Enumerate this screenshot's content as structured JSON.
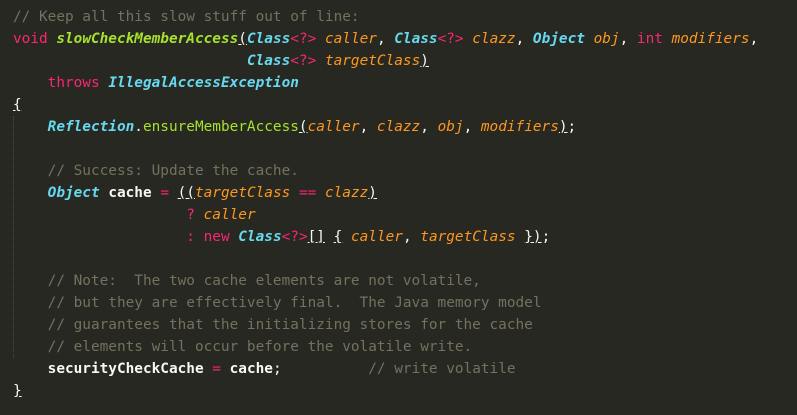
{
  "editor": {
    "theme": {
      "background": "#272822",
      "comment": "#75715E",
      "keyword": "#F92672",
      "type": "#66D9EF",
      "function": "#A6E22E",
      "parameter": "#FD971F",
      "text": "#F8F8F2"
    },
    "lines": [
      [
        {
          "t": "comment",
          "v": "// Keep all this slow stuff out of line:"
        }
      ],
      [
        {
          "t": "keyword",
          "v": "void"
        },
        {
          "t": "plain",
          "v": " "
        },
        {
          "t": "func",
          "v": "slowCheckMemberAccess"
        },
        {
          "t": "bracket",
          "v": "("
        },
        {
          "t": "type",
          "v": "Class"
        },
        {
          "t": "op",
          "v": "<?>"
        },
        {
          "t": "plain",
          "v": " "
        },
        {
          "t": "param",
          "v": "caller"
        },
        {
          "t": "punct",
          "v": ", "
        },
        {
          "t": "type",
          "v": "Class"
        },
        {
          "t": "op",
          "v": "<?>"
        },
        {
          "t": "plain",
          "v": " "
        },
        {
          "t": "param",
          "v": "clazz"
        },
        {
          "t": "punct",
          "v": ", "
        },
        {
          "t": "type",
          "v": "Object"
        },
        {
          "t": "plain",
          "v": " "
        },
        {
          "t": "param",
          "v": "obj"
        },
        {
          "t": "punct",
          "v": ", "
        },
        {
          "t": "keyword",
          "v": "int"
        },
        {
          "t": "plain",
          "v": " "
        },
        {
          "t": "param",
          "v": "modifiers"
        },
        {
          "t": "punct",
          "v": ","
        }
      ],
      [
        {
          "t": "plain",
          "v": "                           "
        },
        {
          "t": "type",
          "v": "Class"
        },
        {
          "t": "op",
          "v": "<?>"
        },
        {
          "t": "plain",
          "v": " "
        },
        {
          "t": "param",
          "v": "targetClass"
        },
        {
          "t": "bracket",
          "v": ")"
        }
      ],
      [
        {
          "t": "plain",
          "v": "    "
        },
        {
          "t": "keyword",
          "v": "throws"
        },
        {
          "t": "plain",
          "v": " "
        },
        {
          "t": "type",
          "v": "IllegalAccessException"
        }
      ],
      [
        {
          "t": "bracket",
          "v": "{"
        }
      ],
      [
        {
          "t": "plain",
          "v": "    "
        },
        {
          "t": "type",
          "v": "Reflection"
        },
        {
          "t": "punct",
          "v": "."
        },
        {
          "t": "method",
          "v": "ensureMemberAccess"
        },
        {
          "t": "bracket",
          "v": "("
        },
        {
          "t": "param",
          "v": "caller"
        },
        {
          "t": "punct",
          "v": ", "
        },
        {
          "t": "param",
          "v": "clazz"
        },
        {
          "t": "punct",
          "v": ", "
        },
        {
          "t": "param",
          "v": "obj"
        },
        {
          "t": "punct",
          "v": ", "
        },
        {
          "t": "param",
          "v": "modifiers"
        },
        {
          "t": "bracket",
          "v": ")"
        },
        {
          "t": "punct",
          "v": ";"
        }
      ],
      [
        {
          "t": "plain",
          "v": ""
        }
      ],
      [
        {
          "t": "plain",
          "v": "    "
        },
        {
          "t": "comment",
          "v": "// Success: Update the cache."
        }
      ],
      [
        {
          "t": "plain",
          "v": "    "
        },
        {
          "t": "type",
          "v": "Object"
        },
        {
          "t": "plain",
          "v": " "
        },
        {
          "t": "bold",
          "v": "cache"
        },
        {
          "t": "plain",
          "v": " "
        },
        {
          "t": "op",
          "v": "="
        },
        {
          "t": "plain",
          "v": " "
        },
        {
          "t": "bracket",
          "v": "(("
        },
        {
          "t": "param",
          "v": "targetClass"
        },
        {
          "t": "plain",
          "v": " "
        },
        {
          "t": "op",
          "v": "=="
        },
        {
          "t": "plain",
          "v": " "
        },
        {
          "t": "param",
          "v": "clazz"
        },
        {
          "t": "bracket",
          "v": ")"
        }
      ],
      [
        {
          "t": "plain",
          "v": "                    "
        },
        {
          "t": "op",
          "v": "?"
        },
        {
          "t": "plain",
          "v": " "
        },
        {
          "t": "param",
          "v": "caller"
        }
      ],
      [
        {
          "t": "plain",
          "v": "                    "
        },
        {
          "t": "op",
          "v": ":"
        },
        {
          "t": "plain",
          "v": " "
        },
        {
          "t": "keyword",
          "v": "new"
        },
        {
          "t": "plain",
          "v": " "
        },
        {
          "t": "type",
          "v": "Class"
        },
        {
          "t": "op",
          "v": "<?>"
        },
        {
          "t": "bracket",
          "v": "[]"
        },
        {
          "t": "plain",
          "v": " "
        },
        {
          "t": "bracket",
          "v": "{"
        },
        {
          "t": "plain",
          "v": " "
        },
        {
          "t": "param",
          "v": "caller"
        },
        {
          "t": "punct",
          "v": ", "
        },
        {
          "t": "param",
          "v": "targetClass"
        },
        {
          "t": "plain",
          "v": " "
        },
        {
          "t": "bracket",
          "v": "})"
        },
        {
          "t": "punct",
          "v": ";"
        }
      ],
      [
        {
          "t": "plain",
          "v": ""
        }
      ],
      [
        {
          "t": "plain",
          "v": "    "
        },
        {
          "t": "comment",
          "v": "// Note:  The two cache elements are not volatile,"
        }
      ],
      [
        {
          "t": "plain",
          "v": "    "
        },
        {
          "t": "comment",
          "v": "// but they are effectively final.  The Java memory model"
        }
      ],
      [
        {
          "t": "plain",
          "v": "    "
        },
        {
          "t": "comment",
          "v": "// guarantees that the initializing stores for the cache"
        }
      ],
      [
        {
          "t": "plain",
          "v": "    "
        },
        {
          "t": "comment",
          "v": "// elements will occur before the volatile write."
        }
      ],
      [
        {
          "t": "plain",
          "v": "    "
        },
        {
          "t": "bold",
          "v": "securityCheckCache"
        },
        {
          "t": "plain",
          "v": " "
        },
        {
          "t": "op",
          "v": "="
        },
        {
          "t": "plain",
          "v": " "
        },
        {
          "t": "bold",
          "v": "cache"
        },
        {
          "t": "punct",
          "v": ";"
        },
        {
          "t": "plain",
          "v": "          "
        },
        {
          "t": "comment",
          "v": "// write volatile"
        }
      ],
      [
        {
          "t": "bracket",
          "v": "}"
        }
      ]
    ]
  }
}
